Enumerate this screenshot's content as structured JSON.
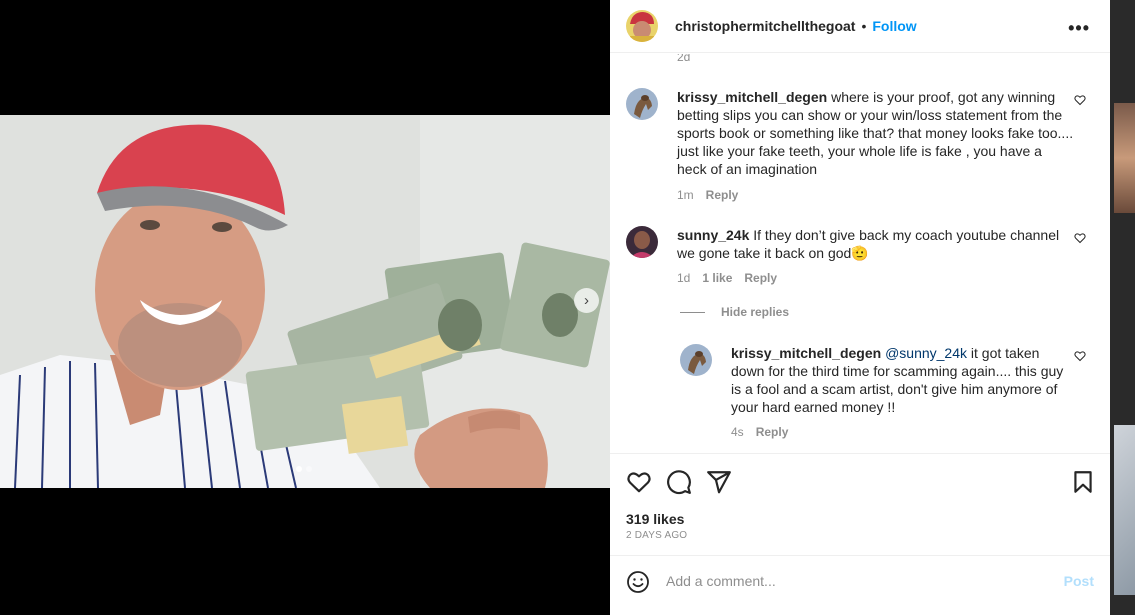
{
  "post": {
    "author": "christophermitchellthegoat",
    "separator": "•",
    "follow_label": "Follow",
    "more_label": "•••",
    "cutoff_time": "2d",
    "next_icon": "chevron-right-icon"
  },
  "comments": [
    {
      "user": "krissy_mitchell_degen",
      "text": "where is your proof, got any winning betting slips you can show or your win/loss statement from the sports book or something like that? that money looks fake too.... just like your fake teeth, your whole life is fake , you have a heck of an imagination",
      "time": "1m",
      "reply_label": "Reply"
    },
    {
      "user": "sunny_24k",
      "text": "If they don’t give back my coach youtube channel we gone take it back on god🫡",
      "time": "1d",
      "likes": "1 like",
      "reply_label": "Reply",
      "hide_replies": "Hide replies",
      "replies": [
        {
          "user": "krissy_mitchell_degen",
          "mention": "@sunny_24k",
          "text": "it got taken down for the third time for scamming again.... this guy is a fool and a scam artist, don't give him anymore of your hard earned money !!",
          "time": "4s",
          "reply_label": "Reply"
        }
      ]
    }
  ],
  "stats": {
    "likes": "319 likes",
    "date": "2 DAYS AGO"
  },
  "composer": {
    "placeholder": "Add a comment...",
    "post_label": "Post"
  },
  "colors": {
    "accent": "#0095f6",
    "post_disabled": "#b2dffc",
    "mention": "#00376b",
    "muted": "#8e8e8e"
  }
}
